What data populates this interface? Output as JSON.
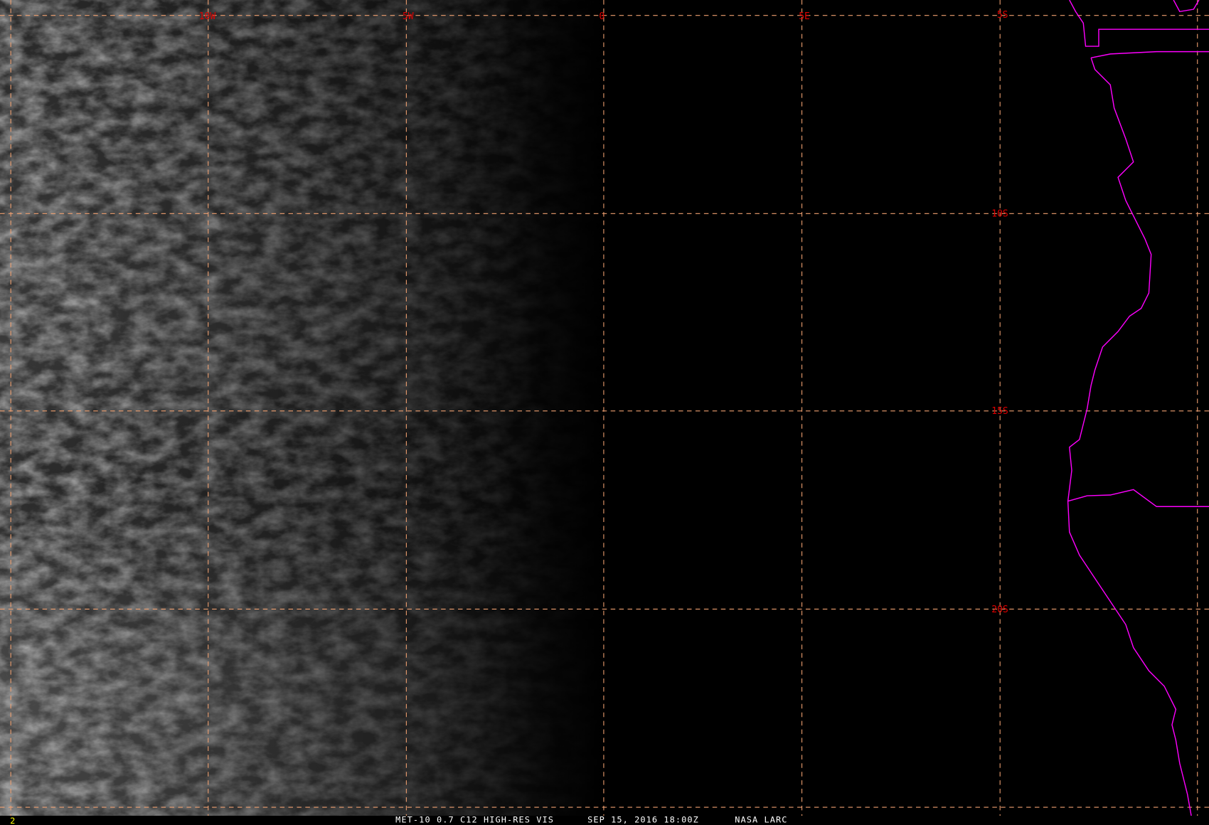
{
  "colors": {
    "grid": "#f0a070",
    "label": "#e00000",
    "coast": "#ff00ff",
    "frame": "#ffff00",
    "text": "#ffffff"
  },
  "grid": {
    "lon_labels": [
      "10W",
      "5W",
      "0",
      "5E"
    ],
    "lat_labels": [
      "5S",
      "10S",
      "15S",
      "20S"
    ]
  },
  "footer": {
    "frame_number": "2",
    "product": "MET-10 0.7 C12 HIGH-RES VIS",
    "datetime": "SEP 15, 2016 18:00Z",
    "source": "NASA LARC"
  }
}
